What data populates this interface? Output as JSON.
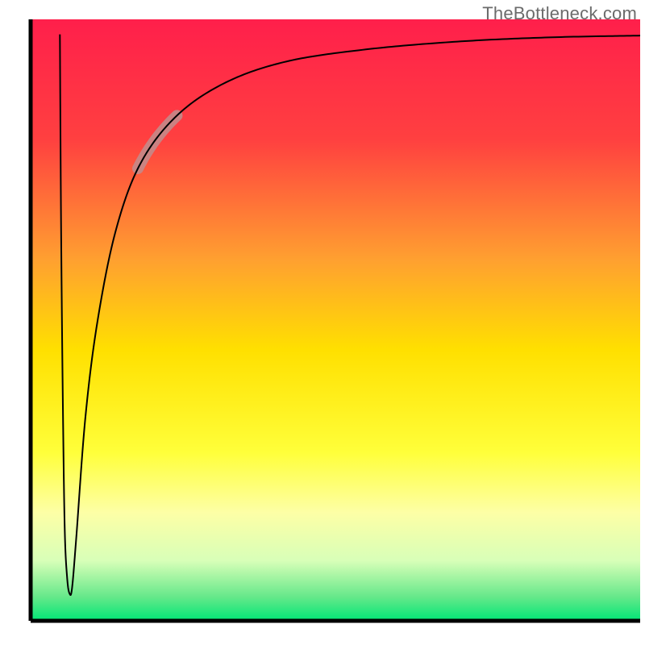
{
  "watermark": "TheBottleneck.com",
  "chart_data": {
    "type": "line",
    "title": "",
    "xlabel": "",
    "ylabel": "",
    "xlim": [
      0,
      100
    ],
    "ylim": [
      0,
      100
    ],
    "axes": {
      "left": true,
      "bottom": true,
      "right": false,
      "top": false,
      "ticks": false,
      "grid": false
    },
    "background_gradient": {
      "direction": "vertical",
      "stops": [
        {
          "offset": 0.0,
          "color": "#ff1f4b"
        },
        {
          "offset": 0.2,
          "color": "#ff4040"
        },
        {
          "offset": 0.4,
          "color": "#ffa030"
        },
        {
          "offset": 0.55,
          "color": "#ffe000"
        },
        {
          "offset": 0.72,
          "color": "#ffff3a"
        },
        {
          "offset": 0.82,
          "color": "#fdffa6"
        },
        {
          "offset": 0.9,
          "color": "#d8ffb8"
        },
        {
          "offset": 0.96,
          "color": "#66e88a"
        },
        {
          "offset": 1.0,
          "color": "#00e676"
        }
      ]
    },
    "series": [
      {
        "name": "bottleneck-curve",
        "color": "#000000",
        "width": 2.0,
        "note": "Curve rises sharply from the bottom-left minimum then asymptotically approaches the top ceiling.",
        "points": [
          {
            "x": 4.8,
            "y": 97.5
          },
          {
            "x": 5.0,
            "y": 65.0
          },
          {
            "x": 5.3,
            "y": 35.0
          },
          {
            "x": 5.6,
            "y": 15.0
          },
          {
            "x": 6.0,
            "y": 7.0
          },
          {
            "x": 6.4,
            "y": 4.5
          },
          {
            "x": 6.8,
            "y": 5.5
          },
          {
            "x": 7.5,
            "y": 14.0
          },
          {
            "x": 9.0,
            "y": 34.0
          },
          {
            "x": 11.0,
            "y": 50.0
          },
          {
            "x": 14.0,
            "y": 65.0
          },
          {
            "x": 18.0,
            "y": 76.0
          },
          {
            "x": 24.0,
            "y": 84.0
          },
          {
            "x": 32.0,
            "y": 89.5
          },
          {
            "x": 42.0,
            "y": 93.0
          },
          {
            "x": 55.0,
            "y": 95.0
          },
          {
            "x": 70.0,
            "y": 96.3
          },
          {
            "x": 85.0,
            "y": 97.0
          },
          {
            "x": 100.0,
            "y": 97.3
          }
        ]
      }
    ],
    "highlight": {
      "name": "highlighted-segment",
      "color": "#c48a8a",
      "opacity": 0.9,
      "width": 14,
      "x_range": [
        17.5,
        24.0
      ],
      "note": "Thick translucent rose overlay drawn on top of main curve in this x-range."
    }
  }
}
